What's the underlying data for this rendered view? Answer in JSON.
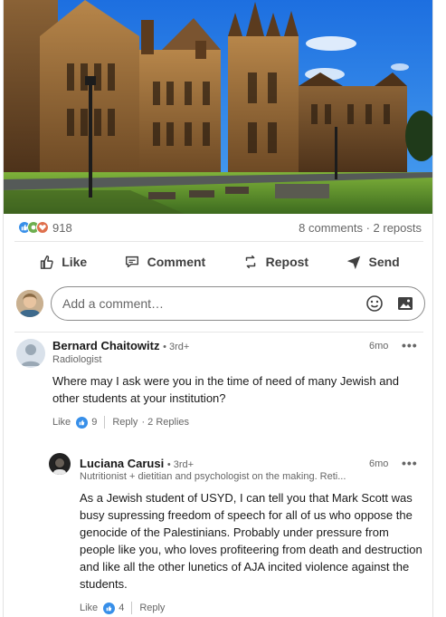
{
  "post": {
    "reaction_count": "918",
    "stats": "8 comments · 2 reposts",
    "reaction_icons": [
      "like-icon",
      "celebrate-icon",
      "love-icon"
    ],
    "colors": {
      "like": "#378fe9",
      "celebrate": "#6dae4f",
      "love": "#df704d"
    }
  },
  "actions": {
    "like": "Like",
    "comment": "Comment",
    "repost": "Repost",
    "send": "Send"
  },
  "add_comment": {
    "placeholder": "Add a comment…",
    "emoji_icon": "emoji-icon",
    "image_icon": "image-icon"
  },
  "comments": [
    {
      "name": "Bernard Chaitowitz",
      "degree": "• 3rd+",
      "headline": "Radiologist",
      "time": "6mo",
      "more": "•••",
      "text": "Where may I ask were you in the time of need of many Jewish and other students at your institution?",
      "like_label": "Like",
      "likes": "9",
      "reply_label": "Reply",
      "replies": "· 2 Replies"
    },
    {
      "name": "Luciana Carusi",
      "degree": "• 3rd+",
      "headline": "Nutritionist + dietitian and psychologist on the making. Reti...",
      "time": "6mo",
      "more": "•••",
      "text": "As a Jewish student of USYD, I can tell you that Mark Scott was busy supressing freedom of speech for all of us who oppose the genocide of the Palestinians. Probably under pressure from people like you, who loves profiteering from death and destruction and like all the other lunetics of AJA incited violence against the students.",
      "like_label": "Like",
      "likes": "4",
      "reply_label": "Reply"
    }
  ]
}
